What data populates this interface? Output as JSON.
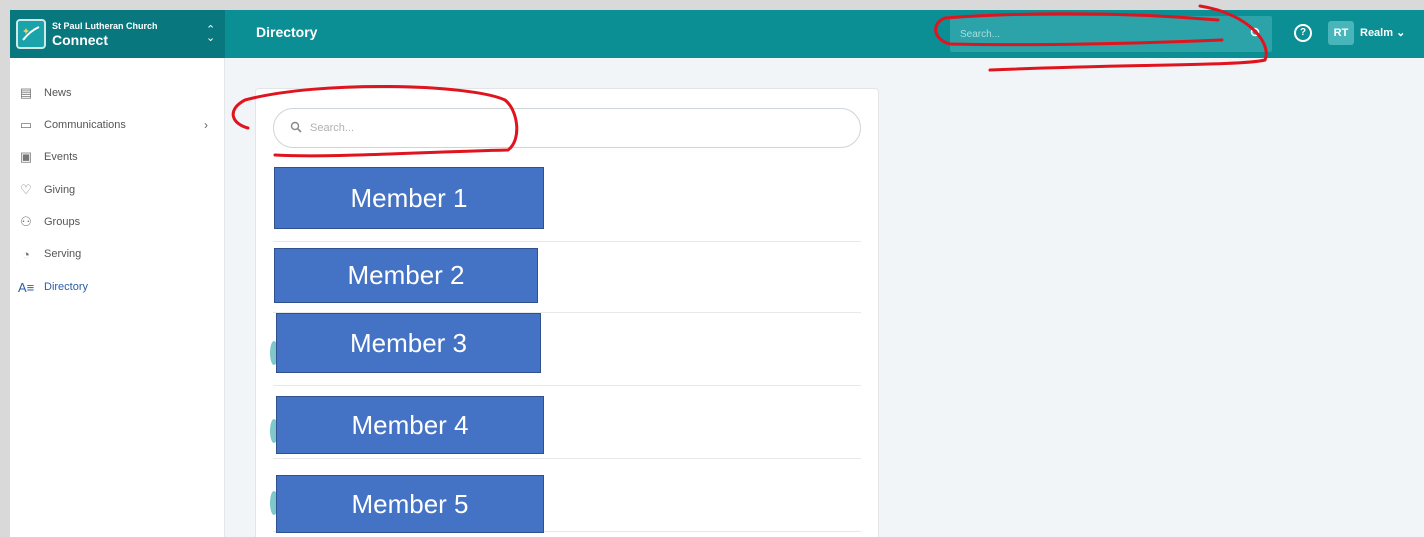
{
  "org": {
    "name": "St Paul Lutheran Church",
    "app": "Connect",
    "switch_icon": "chevron-up-down-icon"
  },
  "header": {
    "title": "Directory",
    "search_placeholder": "Search...",
    "help_icon": "help-icon",
    "user_initials": "RT",
    "user_name": "Realm ⌄"
  },
  "sidebar": {
    "items": [
      {
        "label": "News",
        "icon": "news-icon"
      },
      {
        "label": "Communications",
        "icon": "communications-icon",
        "has_submenu": true
      },
      {
        "label": "Events",
        "icon": "events-icon"
      },
      {
        "label": "Giving",
        "icon": "giving-icon"
      },
      {
        "label": "Groups",
        "icon": "groups-icon"
      },
      {
        "label": "Serving",
        "icon": "serving-icon"
      },
      {
        "label": "Directory",
        "icon": "directory-icon",
        "active": true
      }
    ],
    "active_color": "#2a5ea8",
    "submenu_chevron": "›"
  },
  "directory": {
    "search_placeholder": "Search...",
    "members": [
      "Member 1",
      "Member 2",
      "Member 3",
      "Member 4",
      "Member 5"
    ]
  },
  "colors": {
    "header": "#0b8f95",
    "org_block": "#08787e",
    "member_box": "#4472c4",
    "annotation": "#e0141e"
  }
}
